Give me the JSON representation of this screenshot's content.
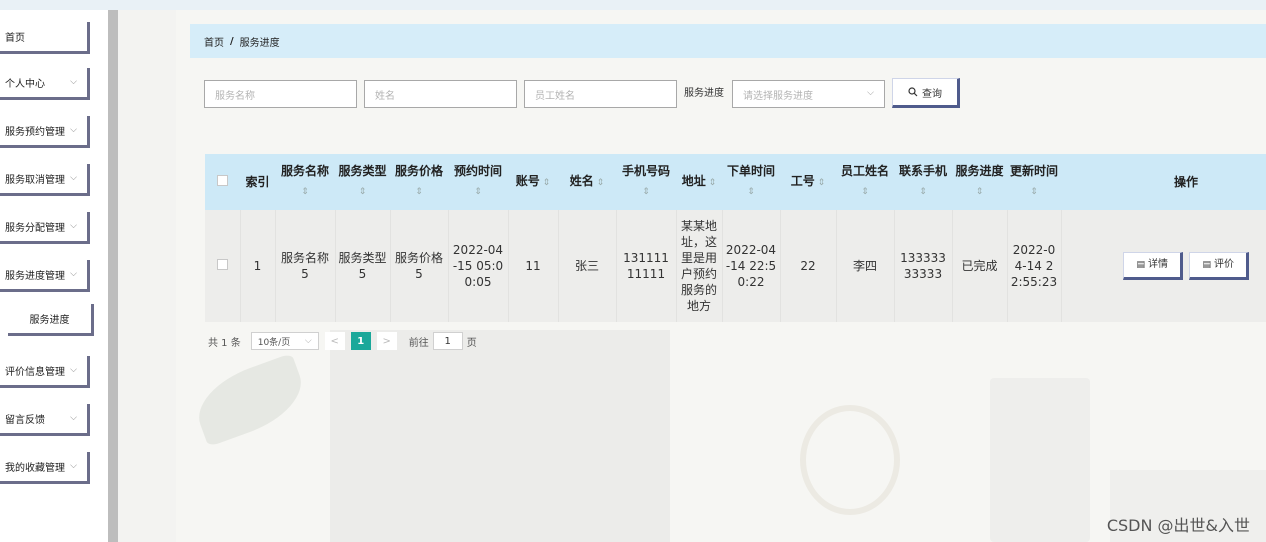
{
  "sidebar": {
    "items": [
      {
        "label": "首页",
        "chevron": false
      },
      {
        "label": "个人中心",
        "chevron": true
      },
      {
        "label": "服务预约管理",
        "chevron": true
      },
      {
        "label": "服务取消管理",
        "chevron": true
      },
      {
        "label": "服务分配管理",
        "chevron": true
      },
      {
        "label": "服务进度管理",
        "chevron": true
      },
      {
        "label": "服务进度",
        "chevron": false,
        "sub": true
      },
      {
        "label": "评价信息管理",
        "chevron": true
      },
      {
        "label": "留言反馈",
        "chevron": true
      },
      {
        "label": "我的收藏管理",
        "chevron": true
      }
    ]
  },
  "breadcrumb": {
    "home": "首页",
    "separator": "/",
    "current": "服务进度"
  },
  "search": {
    "service_name_placeholder": "服务名称",
    "name_placeholder": "姓名",
    "employee_name_placeholder": "员工姓名",
    "progress_label": "服务进度",
    "progress_placeholder": "请选择服务进度",
    "query_label": "查询",
    "query_icon": "search-icon"
  },
  "table": {
    "headers": [
      "",
      "索引",
      "服务名称",
      "服务类型",
      "服务价格",
      "预约时间",
      "账号",
      "姓名",
      "手机号码",
      "地址",
      "下单时间",
      "工号",
      "员工姓名",
      "联系手机",
      "服务进度",
      "更新时间",
      "操作"
    ],
    "sortable": [
      false,
      false,
      true,
      true,
      true,
      true,
      true,
      true,
      true,
      true,
      true,
      true,
      true,
      true,
      true,
      true,
      false
    ],
    "rows": [
      {
        "cells": [
          "",
          "1",
          "服务名称5",
          "服务类型5",
          "服务价格5",
          "2022-04-15 05:00:05",
          "11",
          "张三",
          "13111111111",
          "某某地址，这里是用户预约服务的地方",
          "2022-04-14 22:50:22",
          "22",
          "李四",
          "13333333333",
          "已完成",
          "2022-04-14 22:55:23"
        ],
        "actions": [
          "详情",
          "评价"
        ]
      }
    ]
  },
  "pagination": {
    "total_text": "共 1 条",
    "page_size": "10条/页",
    "current_page": "1",
    "goto_label": "前往",
    "goto_value": "1",
    "page_suffix": "页"
  },
  "watermark": "CSDN @出世&入世",
  "colors": {
    "accent": "#1aa89a",
    "header_bg": "#cde9f7",
    "breadcrumb_bg": "#d6edf9",
    "button_shadow": "#4f5b8c"
  }
}
